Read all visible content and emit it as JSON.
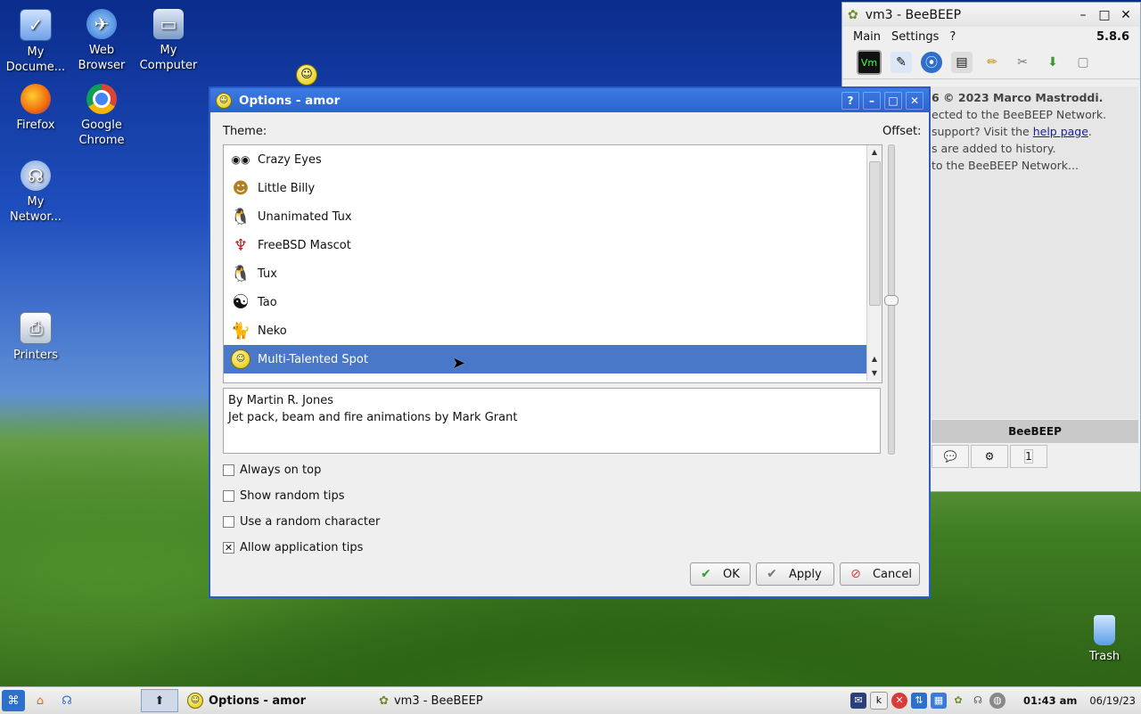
{
  "desktop": {
    "icons": [
      {
        "label": "My Docume...",
        "icon": "documents-icon"
      },
      {
        "label": "Web Browser",
        "icon": "web-browser-icon"
      },
      {
        "label": "My Computer",
        "icon": "computer-icon"
      },
      {
        "label": "Firefox",
        "icon": "firefox-icon"
      },
      {
        "label": "Google Chrome",
        "icon": "chrome-icon"
      },
      {
        "label": "My Networ...",
        "icon": "network-icon"
      },
      {
        "label": "Printers",
        "icon": "printer-icon"
      },
      {
        "label": "Trash",
        "icon": "trash-icon"
      }
    ]
  },
  "beebeep": {
    "title": "vm3 - BeeBEEP",
    "menu": [
      "Main",
      "Settings",
      "?"
    ],
    "version": "5.8.6",
    "toolbar_icon_label": "Vm",
    "lines": [
      "6 © 2023 Marco Mastroddi.",
      "ected to the BeeBEEP Network.",
      "support? Visit the ",
      "s are added to history.",
      "to the BeeBEEP Network..."
    ],
    "help_link": "help page",
    "help_suffix": ".",
    "logo": "BeeBEEP",
    "tab_count": "1"
  },
  "dialog": {
    "title": "Options - amor",
    "theme_label": "Theme:",
    "offset_label": "Offset:",
    "themes": [
      {
        "name": "Crazy Eyes",
        "icon": "eyes-icon"
      },
      {
        "name": "Little Billy",
        "icon": "billy-icon"
      },
      {
        "name": "Unanimated Tux",
        "icon": "tux-icon"
      },
      {
        "name": "FreeBSD Mascot",
        "icon": "bsd-daemon-icon"
      },
      {
        "name": "Tux",
        "icon": "tux-icon"
      },
      {
        "name": "Tao",
        "icon": "yin-yang-icon"
      },
      {
        "name": "Neko",
        "icon": "cat-icon"
      },
      {
        "name": "Multi-Talented Spot",
        "icon": "spot-smiley-icon",
        "selected": true
      }
    ],
    "description": [
      "By Martin R. Jones",
      "Jet pack, beam and fire animations by Mark Grant"
    ],
    "options": [
      {
        "label": "Always on top",
        "checked": false
      },
      {
        "label": "Show random tips",
        "checked": false
      },
      {
        "label": "Use a random character",
        "checked": false
      },
      {
        "label": "Allow application tips",
        "checked": true
      }
    ],
    "buttons": {
      "ok": "OK",
      "apply": "Apply",
      "cancel": "Cancel"
    }
  },
  "taskbar": {
    "windows": [
      {
        "label": "Options - amor",
        "active": true
      },
      {
        "label": "vm3 - BeeBEEP",
        "active": false
      }
    ],
    "time": "01:43 am",
    "date": "06/19/23"
  },
  "colors": {
    "selection": "#4a78c9",
    "dialog_title": "#2b63cf",
    "cancel_red": "#d93a3a",
    "ok_green": "#2f9e2f"
  }
}
